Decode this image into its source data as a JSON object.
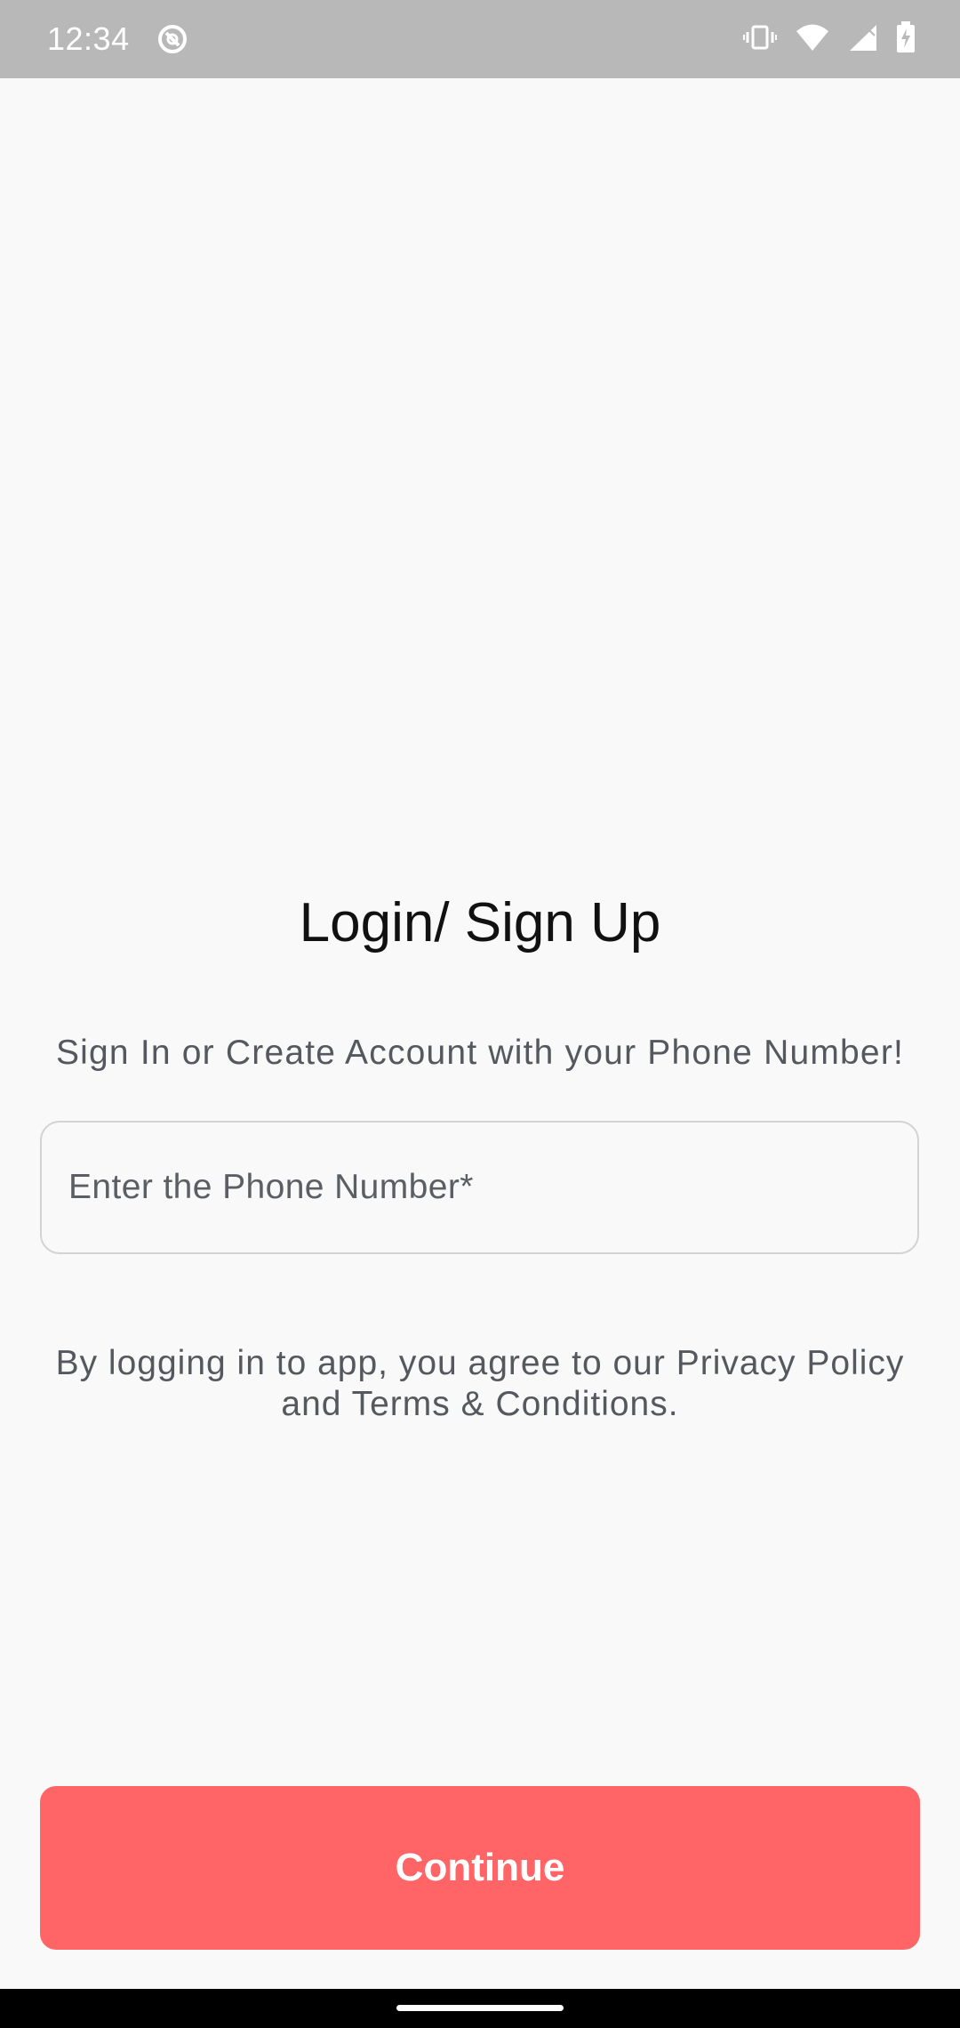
{
  "status_bar": {
    "time": "12:34",
    "icons": [
      "app-notification-icon",
      "vibrate-icon",
      "wifi-icon",
      "signal-icon",
      "battery-charging-icon"
    ]
  },
  "login": {
    "title": "Login/ Sign Up",
    "subtitle": "Sign In or Create Account with your Phone Number!",
    "phone_placeholder": "Enter the Phone Number*",
    "phone_value": "",
    "terms_line1": "By logging in to app, you agree to our Privacy Policy",
    "terms_line2": "and Terms & Conditions.",
    "continue_label": "Continue"
  },
  "colors": {
    "accent": "#ff6566",
    "background": "#f9f9f9",
    "status_bar": "#b8b8b8",
    "muted_text": "#55585e"
  }
}
